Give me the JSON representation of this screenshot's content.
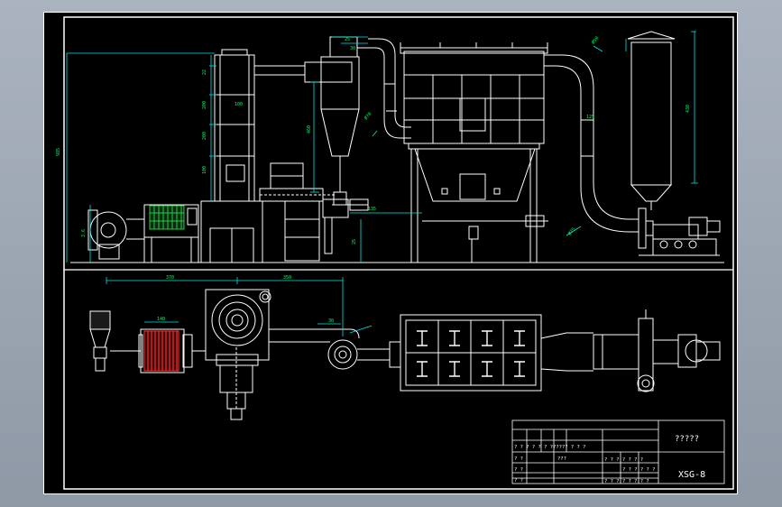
{
  "title_block": {
    "drawing_name": "?????",
    "drawing_code": "XSG-8",
    "header_row": "? ? ? ? ? ? ?????? ? ? ?",
    "row2_left": "? ?",
    "row2_mid": "???",
    "row3_left": "? ?",
    "row3_scale": "? ? ? ? ? ? ?",
    "row3_b": "? ? ? ? ? ? ? ?",
    "row4_left": "? ?",
    "row4_right": "? ? ? ? ? ?"
  },
  "dimensions": {
    "height_main": "985",
    "tower_h1": "22",
    "tower_h2": "200",
    "tower_h3": "200",
    "tower_h4": "100",
    "cyclone_h": "460",
    "duct_h": "100",
    "stack_h": "430",
    "plan_w1": "370",
    "plan_w2": "350",
    "heater_w": "140",
    "cyc_w": "30",
    "small1": "25",
    "small2": "30",
    "duct_diag1": "Ø70",
    "duct_diag2": "Ø50",
    "pipe_diag": "Ø75",
    "bag_dim": "3.6",
    "base_h": "25",
    "feed_h": "135",
    "bend_dim": "125"
  },
  "colors": {
    "line": "#ffffff",
    "dim": "#00e5e5",
    "text": "#00ff66",
    "heater_plan": "#ff3030",
    "heater_elev": "#22cc44",
    "frame": "#ffffff"
  }
}
